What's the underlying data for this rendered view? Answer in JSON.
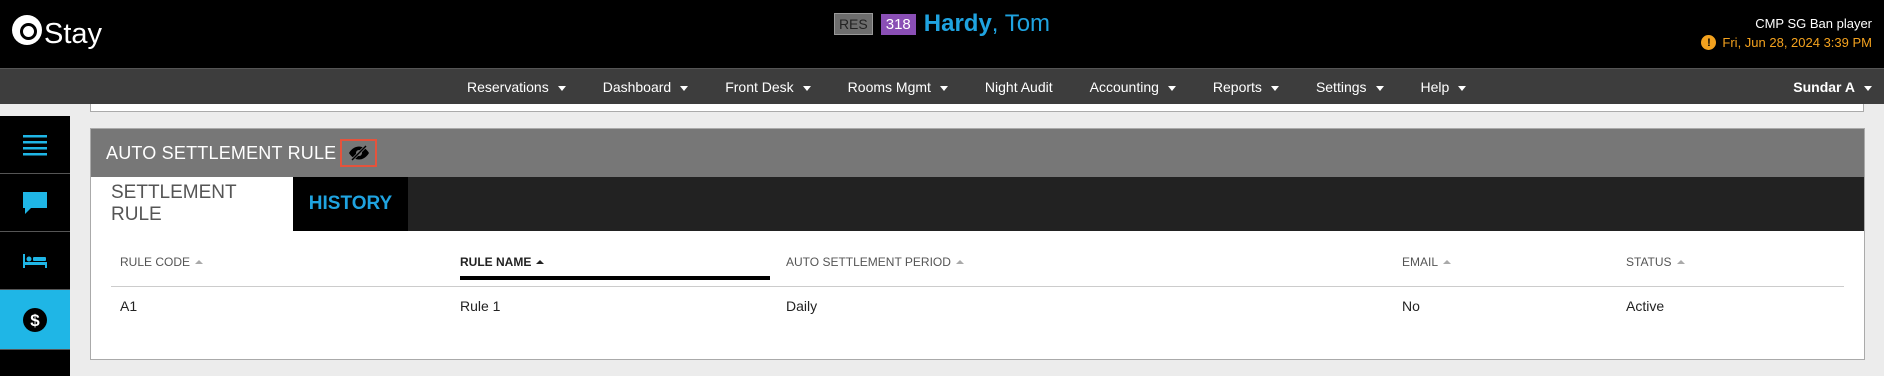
{
  "app": {
    "logo_text": "Stay"
  },
  "guest": {
    "res_badge": "RES",
    "room_number": "318",
    "last_name": "Hardy",
    "first_name_part": ", Tom"
  },
  "header_right": {
    "property": "CMP SG Ban player",
    "datetime": "Fri, Jun 28, 2024 3:39 PM",
    "warning_icon": "!"
  },
  "nav": {
    "items": [
      {
        "label": "Reservations",
        "has_dropdown": true
      },
      {
        "label": "Dashboard",
        "has_dropdown": true
      },
      {
        "label": "Front Desk",
        "has_dropdown": true
      },
      {
        "label": "Rooms Mgmt",
        "has_dropdown": true
      },
      {
        "label": "Night Audit",
        "has_dropdown": false
      },
      {
        "label": "Accounting",
        "has_dropdown": true
      },
      {
        "label": "Reports",
        "has_dropdown": true
      },
      {
        "label": "Settings",
        "has_dropdown": true
      },
      {
        "label": "Help",
        "has_dropdown": true
      }
    ],
    "user": "Sundar A"
  },
  "sidebar": {
    "items": [
      {
        "icon": "menu-list-icon"
      },
      {
        "icon": "chat-icon"
      },
      {
        "icon": "bed-icon"
      },
      {
        "icon": "dollar-icon",
        "active": true
      }
    ]
  },
  "panel": {
    "title": "AUTO SETTLEMENT RULE",
    "toggle_icon": "eye-slash-icon",
    "tabs": [
      {
        "label": "SETTLEMENT RULE",
        "active": true
      },
      {
        "label": "HISTORY",
        "active": false
      }
    ],
    "table": {
      "headers": [
        {
          "label": "RULE CODE",
          "sorted": false
        },
        {
          "label": "RULE NAME",
          "sorted": true,
          "direction": "asc"
        },
        {
          "label": "AUTO SETTLEMENT PERIOD",
          "sorted": false
        },
        {
          "label": "EMAIL",
          "sorted": false
        },
        {
          "label": "STATUS",
          "sorted": false
        }
      ],
      "rows": [
        {
          "rule_code": "A1",
          "rule_name": "Rule 1",
          "period": "Daily",
          "email": "No",
          "status": "Active"
        }
      ]
    }
  },
  "colors": {
    "accent_blue": "#1fa3e0",
    "sidebar_active": "#1fb6e6",
    "warning": "#f4a21e",
    "room_badge": "#8a4fb5",
    "highlight_border": "#e5533c"
  }
}
